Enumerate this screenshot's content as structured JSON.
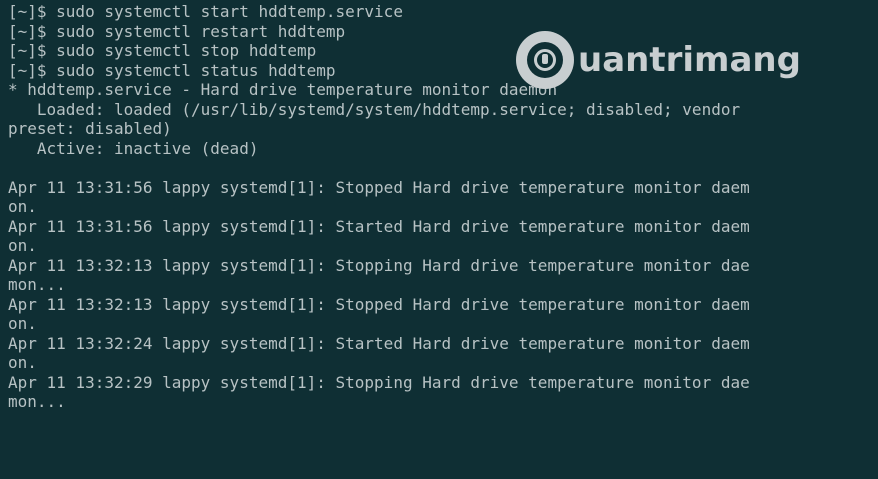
{
  "watermark": {
    "text": "uantrimang",
    "icon": "bulb-q-icon"
  },
  "terminal": {
    "lines": [
      "[~]$ sudo systemctl start hddtemp.service",
      "[~]$ sudo systemctl restart hddtemp",
      "[~]$ sudo systemctl stop hddtemp",
      "[~]$ sudo systemctl status hddtemp",
      "* hddtemp.service - Hard drive temperature monitor daemon",
      "   Loaded: loaded (/usr/lib/systemd/system/hddtemp.service; disabled; vendor",
      "preset: disabled)",
      "   Active: inactive (dead)",
      "",
      "Apr 11 13:31:56 lappy systemd[1]: Stopped Hard drive temperature monitor daem",
      "on.",
      "Apr 11 13:31:56 lappy systemd[1]: Started Hard drive temperature monitor daem",
      "on.",
      "Apr 11 13:32:13 lappy systemd[1]: Stopping Hard drive temperature monitor dae",
      "mon...",
      "Apr 11 13:32:13 lappy systemd[1]: Stopped Hard drive temperature monitor daem",
      "on.",
      "Apr 11 13:32:24 lappy systemd[1]: Started Hard drive temperature monitor daem",
      "on.",
      "Apr 11 13:32:29 lappy systemd[1]: Stopping Hard drive temperature monitor dae",
      "mon..."
    ]
  },
  "colors": {
    "background": "#0f2f34",
    "text": "#b7c2c4",
    "watermark": "#c8ced0"
  }
}
